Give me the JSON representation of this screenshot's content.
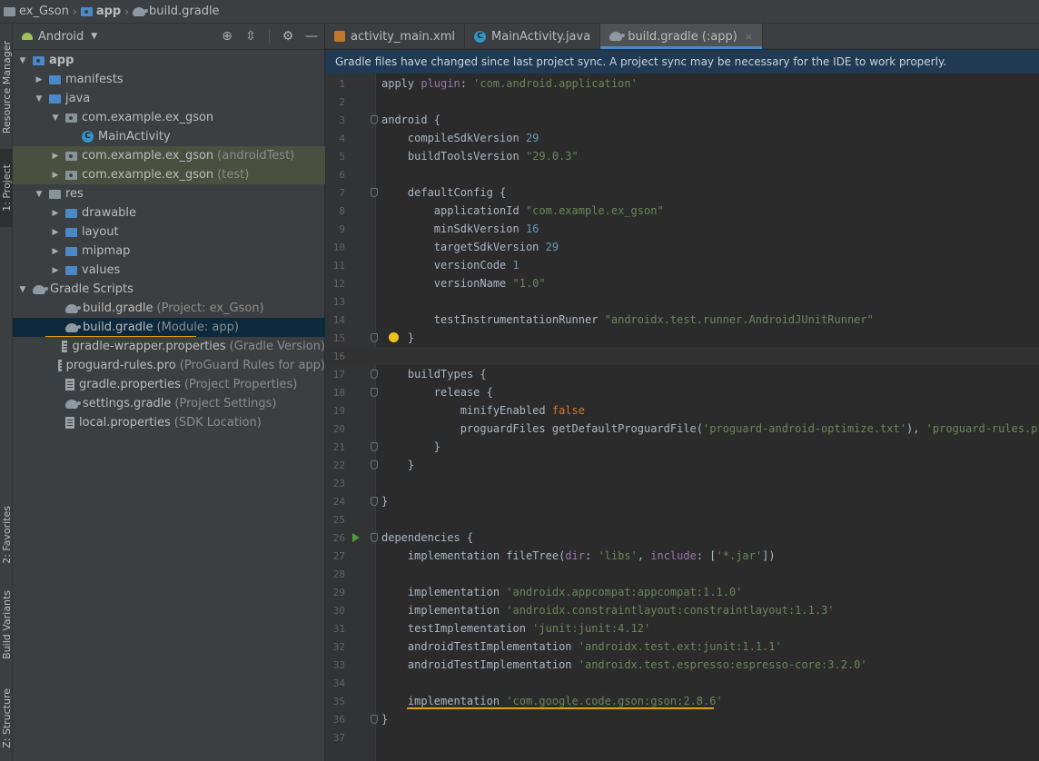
{
  "breadcrumb": {
    "items": [
      {
        "label": "ex_Gson",
        "icon": "folder-icon"
      },
      {
        "label": "app",
        "icon": "module-folder-icon"
      },
      {
        "label": "build.gradle",
        "icon": "gradle-icon"
      }
    ]
  },
  "left_strip": {
    "tabs": [
      {
        "label": "Resource Manager"
      },
      {
        "label": "1: Project",
        "active": true
      },
      {
        "label": "2: Favorites"
      },
      {
        "label": "Build Variants"
      },
      {
        "label": "Z: Structure"
      }
    ]
  },
  "project_panel": {
    "view_label": "Android",
    "tools": [
      "locate-icon",
      "collapse-icon",
      "gear-icon",
      "minimize-icon"
    ],
    "tree": [
      {
        "label": "app",
        "hint": "",
        "icon": "module-folder-icon",
        "expanded": true,
        "depth": 0,
        "bold": true
      },
      {
        "label": "manifests",
        "hint": "",
        "icon": "folder-icon",
        "expanded": false,
        "depth": 1
      },
      {
        "label": "java",
        "hint": "",
        "icon": "folder-icon",
        "expanded": true,
        "depth": 1
      },
      {
        "label": "com.example.ex_gson",
        "hint": "",
        "icon": "package-icon",
        "expanded": true,
        "depth": 2
      },
      {
        "label": "MainActivity",
        "hint": "",
        "icon": "class-icon",
        "depth": 4
      },
      {
        "label": "com.example.ex_gson",
        "hint": "(androidTest)",
        "icon": "package-icon",
        "expanded": false,
        "depth": 2,
        "tinted": true
      },
      {
        "label": "com.example.ex_gson",
        "hint": "(test)",
        "icon": "package-icon",
        "expanded": false,
        "depth": 2,
        "tinted": true
      },
      {
        "label": "res",
        "hint": "",
        "icon": "res-folder-icon",
        "expanded": true,
        "depth": 1
      },
      {
        "label": "drawable",
        "hint": "",
        "icon": "folder-icon",
        "expanded": false,
        "depth": 2
      },
      {
        "label": "layout",
        "hint": "",
        "icon": "folder-icon",
        "expanded": false,
        "depth": 2
      },
      {
        "label": "mipmap",
        "hint": "",
        "icon": "folder-icon",
        "expanded": false,
        "depth": 2
      },
      {
        "label": "values",
        "hint": "",
        "icon": "folder-icon",
        "expanded": false,
        "depth": 2
      },
      {
        "label": "Gradle Scripts",
        "hint": "",
        "icon": "gradle-icon",
        "expanded": true,
        "depth": 0
      },
      {
        "label": "build.gradle",
        "hint": "(Project: ex_Gson)",
        "icon": "gradle-icon",
        "depth": 2
      },
      {
        "label": "build.gradle",
        "hint": "(Module: app)",
        "icon": "gradle-icon",
        "depth": 2,
        "selected": true
      },
      {
        "label": "gradle-wrapper.properties",
        "hint": "(Gradle Version)",
        "icon": "properties-file-icon",
        "depth": 2
      },
      {
        "label": "proguard-rules.pro",
        "hint": "(ProGuard Rules for app)",
        "icon": "file-icon",
        "depth": 2
      },
      {
        "label": "gradle.properties",
        "hint": "(Project Properties)",
        "icon": "properties-file-icon",
        "depth": 2
      },
      {
        "label": "settings.gradle",
        "hint": "(Project Settings)",
        "icon": "gradle-icon",
        "depth": 2
      },
      {
        "label": "local.properties",
        "hint": "(SDK Location)",
        "icon": "properties-file-icon",
        "depth": 2
      }
    ]
  },
  "editor_tabs": [
    {
      "label": "activity_main.xml",
      "icon": "xml-file-icon",
      "active": false
    },
    {
      "label": "MainActivity.java",
      "icon": "java-class-icon",
      "active": false
    },
    {
      "label": "build.gradle (:app)",
      "icon": "gradle-icon",
      "active": true,
      "close": "×"
    }
  ],
  "sync_banner": "Gradle files have changed since last project sync. A project sync may be necessary for the IDE to work properly.",
  "editor": {
    "current_line": 16,
    "lines": [
      {
        "n": "1",
        "parts": [
          [
            "apply ",
            ""
          ],
          [
            "plugin",
            "kw-plugin"
          ],
          [
            ": ",
            ""
          ],
          [
            "'com.android.application'",
            "str"
          ]
        ]
      },
      {
        "n": "2",
        "parts": []
      },
      {
        "n": "3",
        "parts": [
          [
            "android {",
            ""
          ]
        ],
        "fold": true
      },
      {
        "n": "4",
        "parts": [
          [
            "    compileSdkVersion ",
            ""
          ],
          [
            "29",
            "num"
          ]
        ]
      },
      {
        "n": "5",
        "parts": [
          [
            "    buildToolsVersion ",
            ""
          ],
          [
            "\"29.0.3\"",
            "str"
          ]
        ]
      },
      {
        "n": "6",
        "parts": []
      },
      {
        "n": "7",
        "parts": [
          [
            "    defaultConfig {",
            ""
          ]
        ],
        "fold": true
      },
      {
        "n": "8",
        "parts": [
          [
            "        applicationId ",
            ""
          ],
          [
            "\"com.example.ex_gson\"",
            "str"
          ]
        ]
      },
      {
        "n": "9",
        "parts": [
          [
            "        minSdkVersion ",
            ""
          ],
          [
            "16",
            "num"
          ]
        ]
      },
      {
        "n": "10",
        "parts": [
          [
            "        targetSdkVersion ",
            ""
          ],
          [
            "29",
            "num"
          ]
        ]
      },
      {
        "n": "11",
        "parts": [
          [
            "        versionCode ",
            ""
          ],
          [
            "1",
            "num"
          ]
        ]
      },
      {
        "n": "12",
        "parts": [
          [
            "        versionName ",
            ""
          ],
          [
            "\"1.0\"",
            "str"
          ]
        ]
      },
      {
        "n": "13",
        "parts": []
      },
      {
        "n": "14",
        "parts": [
          [
            "        testInstrumentationRunner ",
            ""
          ],
          [
            "\"androidx.test.runner.AndroidJUnitRunner\"",
            "str"
          ]
        ]
      },
      {
        "n": "15",
        "parts": [
          [
            "    }",
            ""
          ]
        ],
        "fold": true,
        "bulb": true
      },
      {
        "n": "16",
        "parts": []
      },
      {
        "n": "17",
        "parts": [
          [
            "    buildTypes {",
            ""
          ]
        ],
        "fold": true
      },
      {
        "n": "18",
        "parts": [
          [
            "        release {",
            ""
          ]
        ],
        "fold": true
      },
      {
        "n": "19",
        "parts": [
          [
            "            minifyEnabled ",
            ""
          ],
          [
            "false",
            "kw"
          ]
        ]
      },
      {
        "n": "20",
        "parts": [
          [
            "            proguardFiles getDefaultProguardFile(",
            ""
          ],
          [
            "'proguard-android-optimize.txt'",
            "str"
          ],
          [
            "), ",
            ""
          ],
          [
            "'proguard-rules.pro'",
            "str"
          ]
        ]
      },
      {
        "n": "21",
        "parts": [
          [
            "        }",
            ""
          ]
        ],
        "fold": true
      },
      {
        "n": "22",
        "parts": [
          [
            "    }",
            ""
          ]
        ],
        "fold": true
      },
      {
        "n": "23",
        "parts": []
      },
      {
        "n": "24",
        "parts": [
          [
            "}",
            ""
          ]
        ],
        "fold": true
      },
      {
        "n": "25",
        "parts": []
      },
      {
        "n": "26",
        "parts": [
          [
            "dependencies {",
            ""
          ]
        ],
        "fold": true,
        "run": true
      },
      {
        "n": "27",
        "parts": [
          [
            "    implementation fileTree(",
            ""
          ],
          [
            "dir",
            "kw-plugin"
          ],
          [
            ": ",
            ""
          ],
          [
            "'libs'",
            "str"
          ],
          [
            ", ",
            ""
          ],
          [
            "include",
            "kw-plugin"
          ],
          [
            ": [",
            ""
          ],
          [
            "'*.jar'",
            "str"
          ],
          [
            "])",
            ""
          ]
        ]
      },
      {
        "n": "28",
        "parts": []
      },
      {
        "n": "29",
        "parts": [
          [
            "    implementation ",
            ""
          ],
          [
            "'androidx.appcompat:appcompat:1.1.0'",
            "str"
          ]
        ]
      },
      {
        "n": "30",
        "parts": [
          [
            "    implementation ",
            ""
          ],
          [
            "'androidx.constraintlayout:constraintlayout:1.1.3'",
            "str"
          ]
        ]
      },
      {
        "n": "31",
        "parts": [
          [
            "    testImplementation ",
            ""
          ],
          [
            "'junit:junit:4.12'",
            "str"
          ]
        ]
      },
      {
        "n": "32",
        "parts": [
          [
            "    androidTestImplementation ",
            ""
          ],
          [
            "'androidx.test.ext:junit:1.1.1'",
            "str"
          ]
        ]
      },
      {
        "n": "33",
        "parts": [
          [
            "    androidTestImplementation ",
            ""
          ],
          [
            "'androidx.test.espresso:espresso-core:3.2.0'",
            "str"
          ]
        ]
      },
      {
        "n": "34",
        "parts": []
      },
      {
        "n": "35",
        "parts": [
          [
            "    implementation ",
            ""
          ],
          [
            "'com.google.code.gson:gson:2.8.6'",
            "str"
          ]
        ],
        "squiggle": true
      },
      {
        "n": "36",
        "parts": [
          [
            "}",
            ""
          ]
        ],
        "fold": true
      },
      {
        "n": "37",
        "parts": []
      }
    ]
  }
}
